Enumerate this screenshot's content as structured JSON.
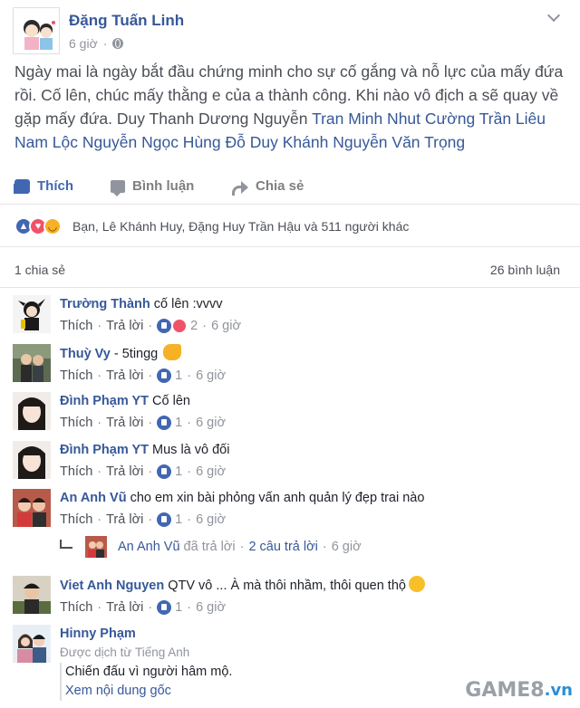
{
  "post": {
    "author": "Đặng Tuấn Linh",
    "time": "6 giờ",
    "sep": "·",
    "text_plain": "Ngày mai là ngày bắt đầu chứng minh cho sự cố gắng và nỗ lực của mấy đứa rồi. Cố lên, chúc mấy thằng e của a thành công. Khi nào vô địch a sẽ quay về gặp mấy đứa. Duy Thanh Dương Nguyễn ",
    "tags": [
      "Tran Minh Nhut Cường",
      "Trần Liêu Nam Lộc",
      "Nguyễn Ngọc Hùng",
      "Đỗ Duy Khánh",
      "Nguyễn Văn Trọng"
    ]
  },
  "actions": {
    "like": "Thích",
    "comment": "Bình luận",
    "share": "Chia sẻ"
  },
  "reactions": {
    "summary": "Bạn, Lê Khánh Huy, Đặng Huy Trần Hậu và 511 người khác"
  },
  "counts": {
    "shares": "1 chia sẻ",
    "comments": "26 bình luận"
  },
  "comment_ui": {
    "like": "Thích",
    "reply": "Trả lời",
    "dot": "·"
  },
  "comments": [
    {
      "author": "Trường Thành",
      "text": "cố lên :vvvv",
      "likes": "2",
      "time": "6 giờ"
    },
    {
      "author": "Thuỳ Vy",
      "text": "- 5tingg",
      "likes": "1",
      "time": "6 giờ"
    },
    {
      "author": "Đình Phạm YT",
      "text": "Cố lên",
      "likes": "1",
      "time": "6 giờ"
    },
    {
      "author": "Đình Phạm YT",
      "text": "Mus là vô đối",
      "likes": "1",
      "time": "6 giờ"
    },
    {
      "author": "An Anh Vũ",
      "text": "cho em xin bài phỏng vấn anh quản lý đẹp trai nào",
      "likes": "1",
      "time": "6 giờ"
    },
    {
      "author": "Viet Anh Nguyen",
      "text": "QTV vô ... À mà thôi nhầm, thôi quen thộ",
      "likes": "1",
      "time": "6 giờ"
    },
    {
      "author": "Hinny Phạm",
      "translated_note": "Được dịch từ Tiếng Anh",
      "translation": "Chiến đấu vì người hâm mộ.",
      "see_original": "Xem nội dung gốc"
    }
  ],
  "reply_summary": {
    "name": "An Anh Vũ",
    "action": "đã trả lời",
    "count": "2 câu trả lời",
    "time": "6 giờ"
  },
  "watermark": {
    "brand": "GAME8",
    "suffix": ".vn"
  }
}
